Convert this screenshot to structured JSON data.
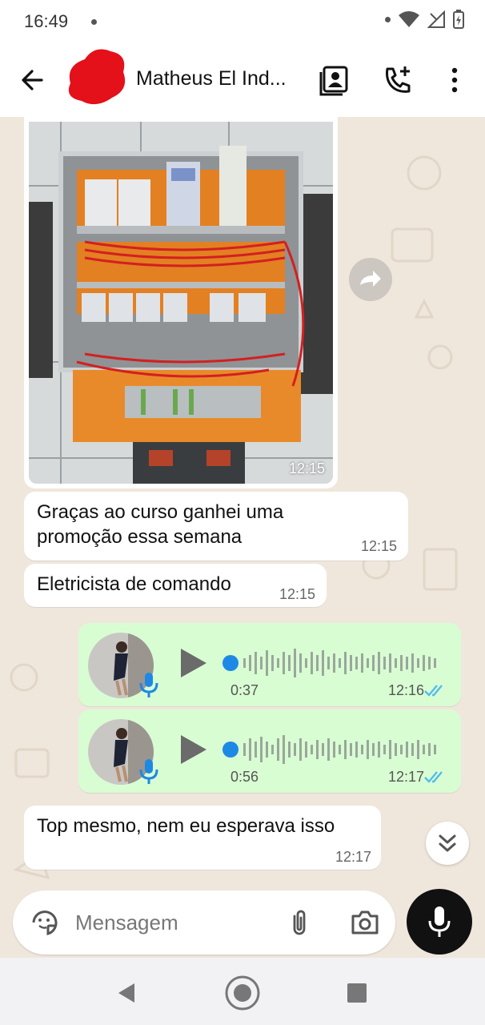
{
  "status_bar": {
    "time": "16:49"
  },
  "header": {
    "contact_name": "Matheus El Ind..."
  },
  "messages": {
    "image_time": "12:15",
    "text1": {
      "line1": "Graças ao curso ganhei uma",
      "line2": "promoção essa semana",
      "time": "12:15"
    },
    "text2": {
      "text": "Eletricista de comando",
      "time": "12:15"
    },
    "voice1": {
      "duration": "0:37",
      "time": "12:16"
    },
    "voice2": {
      "duration": "0:56",
      "time": "12:17"
    },
    "text3": {
      "text": "Top mesmo, nem eu esperava isso",
      "time": "12:17"
    }
  },
  "composer": {
    "placeholder": "Mensagem"
  },
  "colors": {
    "outgoing_bubble": "#d9fdd3",
    "incoming_bubble": "#ffffff",
    "read_ticks": "#53bdeb",
    "voice_dot": "#1e88e5",
    "background": "#efe7dc"
  },
  "icons": [
    "back-arrow-icon",
    "contact-card-icon",
    "call-add-icon",
    "more-vert-icon",
    "forward-icon",
    "play-icon",
    "mic-icon",
    "double-check-icon",
    "chevron-double-down-icon",
    "sticker-icon",
    "attach-icon",
    "camera-icon",
    "nav-back-icon",
    "nav-home-icon",
    "nav-recents-icon"
  ]
}
